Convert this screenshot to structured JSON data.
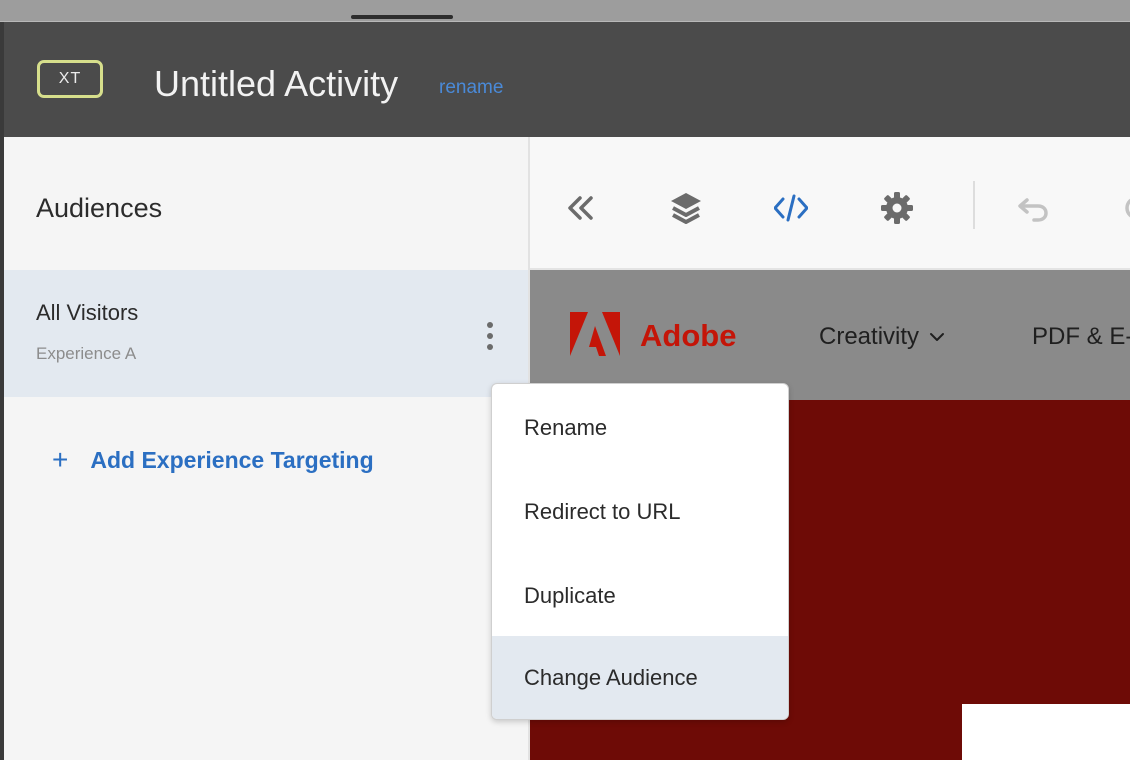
{
  "header": {
    "badge": "XT",
    "title": "Untitled Activity",
    "rename_link": "rename"
  },
  "sidebar": {
    "title": "Audiences",
    "audience": {
      "name": "All Visitors",
      "experience": "Experience A"
    },
    "add_targeting": {
      "icon": "+",
      "label": "Add Experience Targeting"
    }
  },
  "toolbar": {
    "icons": [
      "collapse-icon",
      "layers-icon",
      "code-icon",
      "settings-gear-icon",
      "undo-icon"
    ]
  },
  "preview": {
    "brand": "Adobe",
    "nav": {
      "creativity": "Creativity",
      "pdf": "PDF & E-"
    }
  },
  "context_menu": {
    "items": [
      {
        "label": "Rename"
      },
      {
        "label": "Redirect to URL"
      },
      {
        "label": "Duplicate"
      },
      {
        "label": "Change Audience"
      }
    ],
    "active_item": "Change Audience"
  },
  "colors": {
    "header_bg": "#4b4b4b",
    "accent_blue": "#2b6fc2",
    "badge_border": "#d7df8c",
    "adobe_red": "#c41508",
    "preview_bg": "#6e0b06",
    "selected_row": "#e3e9f0"
  }
}
